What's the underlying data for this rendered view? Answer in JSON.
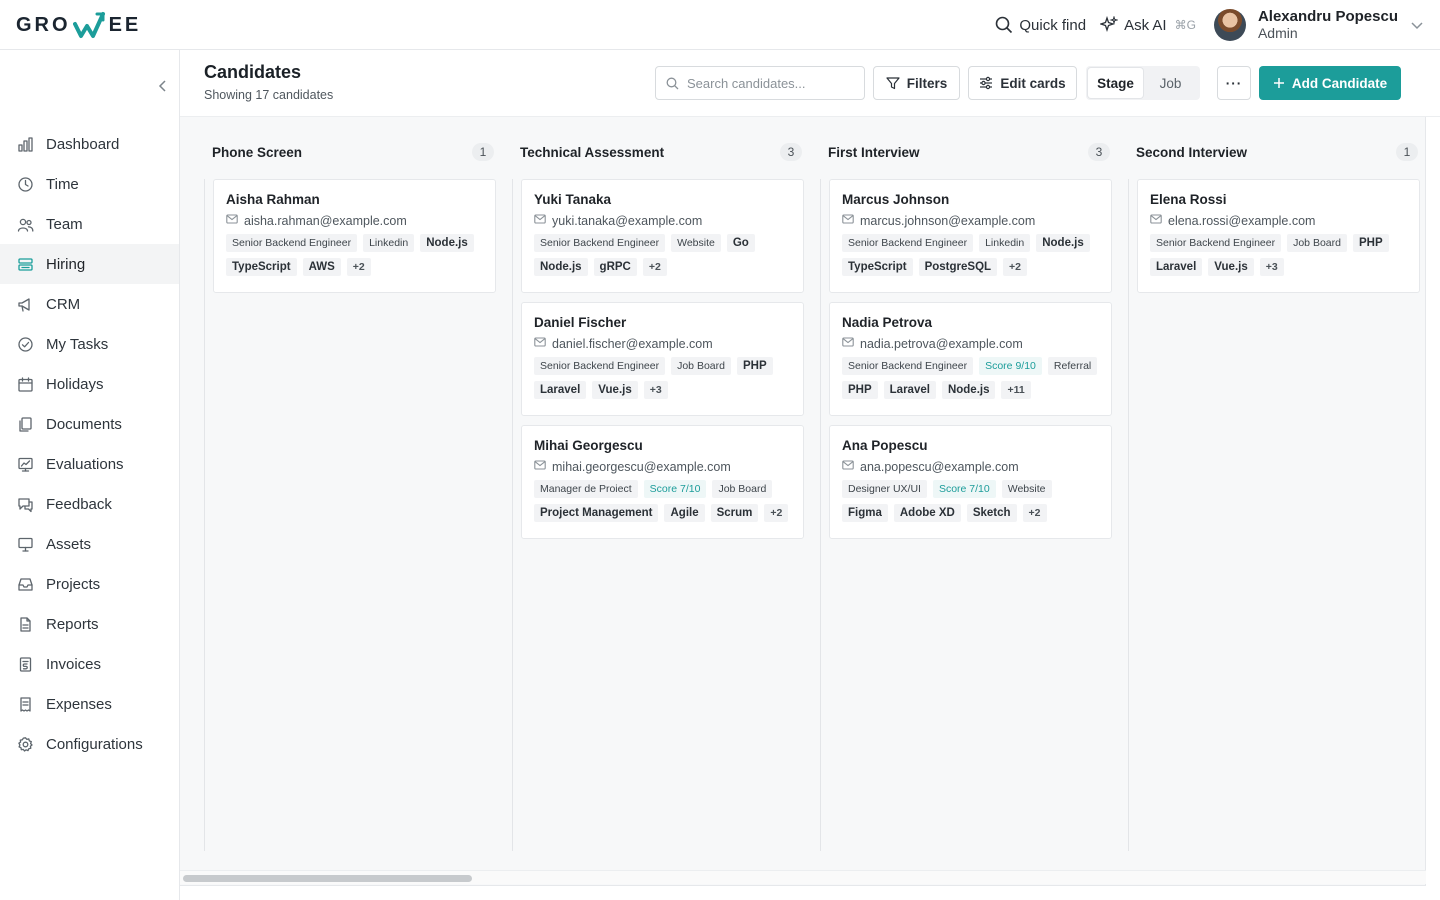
{
  "brand": {
    "logo_left": "GRO",
    "logo_right": "EE",
    "accent": "#1c9d9a"
  },
  "topbar": {
    "quick_find": "Quick find",
    "ask_ai": "Ask AI",
    "ask_ai_shortcut": "⌘G",
    "user_name": "Alexandru Popescu",
    "user_role": "Admin"
  },
  "sidebar": {
    "items": [
      {
        "label": "Dashboard",
        "icon": "bar-chart-icon"
      },
      {
        "label": "Time",
        "icon": "clock-icon"
      },
      {
        "label": "Team",
        "icon": "users-icon"
      },
      {
        "label": "Hiring",
        "icon": "stack-icon",
        "active": true
      },
      {
        "label": "CRM",
        "icon": "megaphone-icon"
      },
      {
        "label": "My Tasks",
        "icon": "check-circle-icon"
      },
      {
        "label": "Holidays",
        "icon": "calendar-icon"
      },
      {
        "label": "Documents",
        "icon": "files-icon"
      },
      {
        "label": "Evaluations",
        "icon": "chart-board-icon"
      },
      {
        "label": "Feedback",
        "icon": "chat-icon"
      },
      {
        "label": "Assets",
        "icon": "monitor-icon"
      },
      {
        "label": "Projects",
        "icon": "inbox-icon"
      },
      {
        "label": "Reports",
        "icon": "file-icon"
      },
      {
        "label": "Invoices",
        "icon": "invoice-icon"
      },
      {
        "label": "Expenses",
        "icon": "receipt-icon"
      },
      {
        "label": "Configurations",
        "icon": "gear-icon"
      }
    ]
  },
  "header": {
    "title": "Candidates",
    "subtitle": "Showing 17 candidates",
    "search_placeholder": "Search candidates...",
    "filters_label": "Filters",
    "edit_cards_label": "Edit cards",
    "toggle_stage": "Stage",
    "toggle_job": "Job",
    "more_label": "···",
    "add_label": "Add Candidate"
  },
  "board": {
    "columns": [
      {
        "title": "Phone Screen",
        "count": "1",
        "cards": [
          {
            "name": "Aisha Rahman",
            "email": "aisha.rahman@example.com",
            "tags": [
              {
                "t": "Senior Backend Engineer",
                "k": "meta"
              },
              {
                "t": "Linkedin",
                "k": "meta"
              },
              {
                "t": "Node.js",
                "k": "skill"
              },
              {
                "t": "TypeScript",
                "k": "skill"
              },
              {
                "t": "AWS",
                "k": "skill"
              },
              {
                "t": "+2",
                "k": "more"
              }
            ]
          }
        ]
      },
      {
        "title": "Technical Assessment",
        "count": "3",
        "cards": [
          {
            "name": "Yuki Tanaka",
            "email": "yuki.tanaka@example.com",
            "tags": [
              {
                "t": "Senior Backend Engineer",
                "k": "meta"
              },
              {
                "t": "Website",
                "k": "meta"
              },
              {
                "t": "Go",
                "k": "skill"
              },
              {
                "t": "Node.js",
                "k": "skill"
              },
              {
                "t": "gRPC",
                "k": "skill"
              },
              {
                "t": "+2",
                "k": "more"
              }
            ]
          },
          {
            "name": "Daniel Fischer",
            "email": "daniel.fischer@example.com",
            "tags": [
              {
                "t": "Senior Backend Engineer",
                "k": "meta"
              },
              {
                "t": "Job Board",
                "k": "meta"
              },
              {
                "t": "PHP",
                "k": "skill"
              },
              {
                "t": "Laravel",
                "k": "skill"
              },
              {
                "t": "Vue.js",
                "k": "skill"
              },
              {
                "t": "+3",
                "k": "more"
              }
            ]
          },
          {
            "name": "Mihai Georgescu",
            "email": "mihai.georgescu@example.com",
            "tags": [
              {
                "t": "Manager de Proiect",
                "k": "meta"
              },
              {
                "t": "Score 7/10",
                "k": "score"
              },
              {
                "t": "Job Board",
                "k": "meta"
              },
              {
                "t": "Project Management",
                "k": "skill"
              },
              {
                "t": "Agile",
                "k": "skill"
              },
              {
                "t": "Scrum",
                "k": "skill"
              },
              {
                "t": "+2",
                "k": "more"
              }
            ]
          }
        ]
      },
      {
        "title": "First Interview",
        "count": "3",
        "cards": [
          {
            "name": "Marcus Johnson",
            "email": "marcus.johnson@example.com",
            "tags": [
              {
                "t": "Senior Backend Engineer",
                "k": "meta"
              },
              {
                "t": "Linkedin",
                "k": "meta"
              },
              {
                "t": "Node.js",
                "k": "skill"
              },
              {
                "t": "TypeScript",
                "k": "skill"
              },
              {
                "t": "PostgreSQL",
                "k": "skill"
              },
              {
                "t": "+2",
                "k": "more"
              }
            ]
          },
          {
            "name": "Nadia Petrova",
            "email": "nadia.petrova@example.com",
            "tags": [
              {
                "t": "Senior Backend Engineer",
                "k": "meta"
              },
              {
                "t": "Score 9/10",
                "k": "score"
              },
              {
                "t": "Referral",
                "k": "meta"
              },
              {
                "t": "PHP",
                "k": "skill"
              },
              {
                "t": "Laravel",
                "k": "skill"
              },
              {
                "t": "Node.js",
                "k": "skill"
              },
              {
                "t": "+11",
                "k": "more"
              }
            ]
          },
          {
            "name": "Ana Popescu",
            "email": "ana.popescu@example.com",
            "tags": [
              {
                "t": "Designer UX/UI",
                "k": "meta"
              },
              {
                "t": "Score 7/10",
                "k": "score"
              },
              {
                "t": "Website",
                "k": "meta"
              },
              {
                "t": "Figma",
                "k": "skill"
              },
              {
                "t": "Adobe XD",
                "k": "skill"
              },
              {
                "t": "Sketch",
                "k": "skill"
              },
              {
                "t": "+2",
                "k": "more"
              }
            ]
          }
        ]
      },
      {
        "title": "Second Interview",
        "count": "1",
        "cards": [
          {
            "name": "Elena Rossi",
            "email": "elena.rossi@example.com",
            "tags": [
              {
                "t": "Senior Backend Engineer",
                "k": "meta"
              },
              {
                "t": "Job Board",
                "k": "meta"
              },
              {
                "t": "PHP",
                "k": "skill"
              },
              {
                "t": "Laravel",
                "k": "skill"
              },
              {
                "t": "Vue.js",
                "k": "skill"
              },
              {
                "t": "+3",
                "k": "more"
              }
            ]
          }
        ]
      }
    ]
  }
}
